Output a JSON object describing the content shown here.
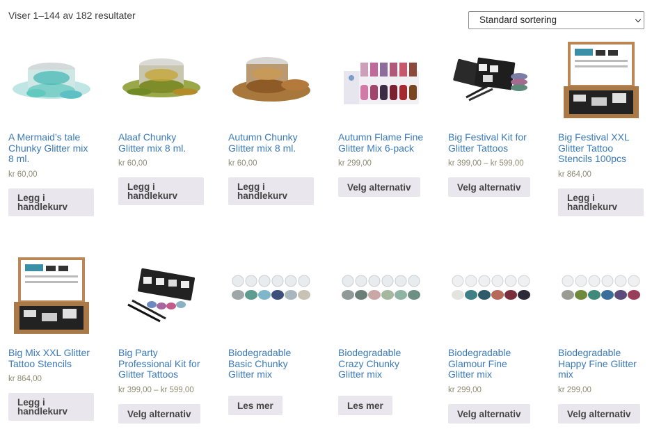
{
  "result_count": "Viser 1–144 av 182 resultater",
  "sort": {
    "selected": "Standard sortering"
  },
  "products": [
    {
      "title": "A Mermaid’s tale Chunky Glitter mix 8 ml.",
      "price": "kr 60,00",
      "button": "Legg i handlekurv",
      "icon": "glitter-jar-teal"
    },
    {
      "title": "Alaaf Chunky Glitter mix 8 ml.",
      "price": "kr 60,00",
      "button": "Legg i handlekurv",
      "icon": "glitter-jar-green-gold"
    },
    {
      "title": "Autumn Chunky Glitter mix 8 ml.",
      "price": "kr 60,00",
      "button": "Legg i handlekurv",
      "icon": "glitter-jar-copper"
    },
    {
      "title": "Autumn Flame Fine Glitter Mix 6-pack",
      "price": "kr 299,00",
      "button": "Velg alternativ",
      "icon": "glitter-6-pack"
    },
    {
      "title": "Big Festival Kit for Glitter Tattoos",
      "price": "kr 399,00 – kr 599,00",
      "button": "Velg alternativ",
      "icon": "tattoo-kit"
    },
    {
      "title": "Big Festival XXL Glitter Tattoo Stencils 100pcs",
      "price": "kr 864,00",
      "button": "Legg i handlekurv",
      "icon": "stencil-box"
    },
    {
      "title": "Big Mix XXL Glitter Tattoo Stencils",
      "price": "kr 864,00",
      "button": "Legg i handlekurv",
      "icon": "stencil-box"
    },
    {
      "title": "Big Party Professional Kit for Glitter Tattoos",
      "price": "kr 399,00 – kr 599,00",
      "button": "Velg alternativ",
      "icon": "tattoo-kit"
    },
    {
      "title": "Biodegradable Basic Chunky Glitter mix",
      "price": "",
      "button": "Les mer",
      "icon": "bio-glitter-row"
    },
    {
      "title": "Biodegradable Crazy Chunky Glitter mix",
      "price": "",
      "button": "Les mer",
      "icon": "bio-glitter-row"
    },
    {
      "title": "Biodegradable Glamour Fine Glitter mix",
      "price": "kr 299,00",
      "button": "Velg alternativ",
      "icon": "bio-glitter-row"
    },
    {
      "title": "Biodegradable Happy Fine Glitter mix",
      "price": "kr 299,00",
      "button": "Velg alternativ",
      "icon": "bio-glitter-row"
    }
  ],
  "colors": {
    "link": "#3a79b8",
    "price": "#8c8c72",
    "button_bg": "#e9e6ed"
  }
}
